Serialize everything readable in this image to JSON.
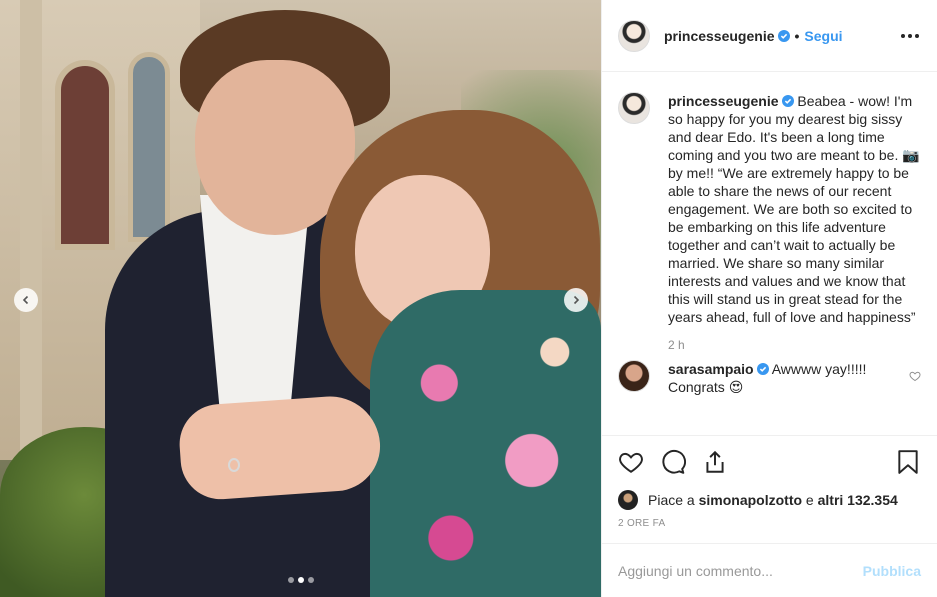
{
  "header": {
    "username": "princesseugenie",
    "separator": "•",
    "follow_label": "Segui"
  },
  "caption": {
    "username": "princesseugenie",
    "text": " Beabea - wow! I'm so happy for you my dearest big sissy and dear Edo. It's been a long time coming and you two are meant to be. 📷 by me!! “We are extremely happy to be able to share the news of our recent engagement. We are both so excited to be embarking on this life adventure together and can’t wait to actually be married. We share so many similar interests and values and we know that this will stand us in great stead for the years ahead, full of love and happiness”",
    "time": "2 h"
  },
  "comments": [
    {
      "username": "sarasampaio",
      "text": " Awwww yay!!!!! Congrats 😍"
    }
  ],
  "likes": {
    "prefix": "Piace a ",
    "user": "simonapolzotto",
    "middle": " e ",
    "others": "altri 132.354"
  },
  "post_time": "2 ORE FA",
  "add_comment": {
    "placeholder": "Aggiungi un commento...",
    "publish_label": "Pubblica"
  },
  "carousel": {
    "current": 2,
    "total": 3
  },
  "icons": {
    "like": "heart-icon",
    "comment": "comment-bubble-icon",
    "share": "share-icon",
    "save": "bookmark-icon",
    "more": "more-options-icon",
    "verified": "verified-badge-icon",
    "prev": "chevron-left-icon",
    "next": "chevron-right-icon"
  },
  "colors": {
    "accent": "#3897f0",
    "publish_disabled": "#b2dffc",
    "muted_text": "#8e8e8e",
    "divider": "#efefef"
  }
}
